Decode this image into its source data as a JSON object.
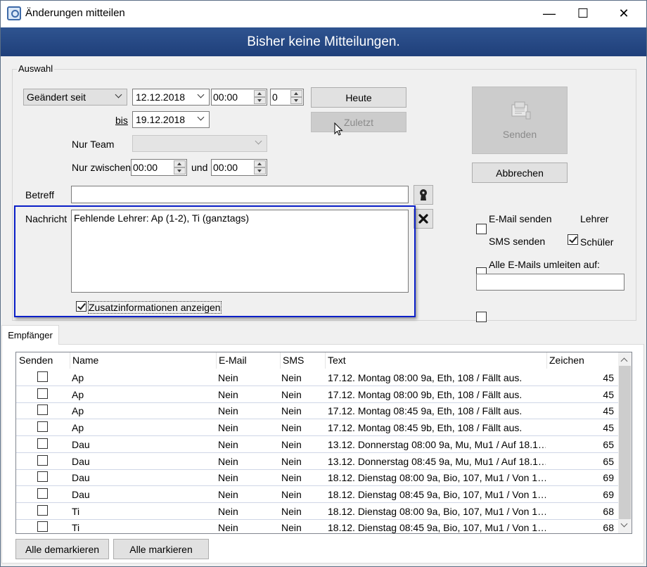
{
  "window": {
    "title": "Änderungen mitteilen",
    "min_glyph": "—",
    "max_glyph": "☐",
    "close_glyph": "✕"
  },
  "banner": {
    "text": "Bisher keine Mitteilungen."
  },
  "auswahl": {
    "legend": "Auswahl",
    "mode_select": "Geändert seit",
    "date_from": "12.12.2018",
    "time_from": "00:00",
    "offset": "0",
    "bis_label": "bis",
    "date_to": "19.12.2018",
    "heute_button": "Heute",
    "zuletzt_button": "Zuletzt",
    "nur_team_label": "Nur Team",
    "nur_team_value": "",
    "nur_zwischen_label": "Nur zwischen",
    "zwischen_from": "00:00",
    "und_label": "und",
    "zwischen_to": "00:00",
    "senden_button": "Senden",
    "abbrechen_button": "Abbrechen",
    "betreff_label": "Betreff",
    "betreff_value": "",
    "nachricht_label": "Nachricht",
    "nachricht_value": "Fehlende Lehrer: Ap (1-2), Ti (ganztags)",
    "zusatz_label": "Zusatzinformationen anzeigen",
    "zusatz_checked": true,
    "email_senden_label": "E-Mail senden",
    "email_senden_checked": false,
    "lehrer_label": "Lehrer",
    "lehrer_checked": true,
    "sms_senden_label": "SMS senden",
    "sms_senden_checked": false,
    "schueler_label": "Schüler",
    "schueler_checked": false,
    "umleiten_label": "Alle E-Mails umleiten auf:",
    "umleiten_checked": false,
    "umleiten_value": ""
  },
  "tabs": {
    "empfaenger": "Empfänger"
  },
  "table": {
    "headers": {
      "senden": "Senden",
      "name": "Name",
      "email": "E-Mail",
      "sms": "SMS",
      "text": "Text",
      "zeichen": "Zeichen"
    },
    "rows": [
      {
        "senden": false,
        "name": "Ap",
        "email": "Nein",
        "sms": "Nein",
        "text": "17.12. Montag 08:00 9a, Eth, 108 / Fällt aus.",
        "zeichen": "45"
      },
      {
        "senden": false,
        "name": "Ap",
        "email": "Nein",
        "sms": "Nein",
        "text": "17.12. Montag 08:00 9b, Eth, 108 / Fällt aus.",
        "zeichen": "45"
      },
      {
        "senden": false,
        "name": "Ap",
        "email": "Nein",
        "sms": "Nein",
        "text": "17.12. Montag 08:45 9a, Eth, 108 / Fällt aus.",
        "zeichen": "45"
      },
      {
        "senden": false,
        "name": "Ap",
        "email": "Nein",
        "sms": "Nein",
        "text": "17.12. Montag 08:45 9b, Eth, 108 / Fällt aus.",
        "zeichen": "45"
      },
      {
        "senden": false,
        "name": "Dau",
        "email": "Nein",
        "sms": "Nein",
        "text": "13.12. Donnerstag 08:00 9a, Mu, Mu1 / Auf 18.1…",
        "zeichen": "65"
      },
      {
        "senden": false,
        "name": "Dau",
        "email": "Nein",
        "sms": "Nein",
        "text": "13.12. Donnerstag 08:45 9a, Mu, Mu1 / Auf 18.1…",
        "zeichen": "65"
      },
      {
        "senden": false,
        "name": "Dau",
        "email": "Nein",
        "sms": "Nein",
        "text": "18.12. Dienstag 08:00 9a, Bio, 107, Mu1 / Von 1…",
        "zeichen": "69"
      },
      {
        "senden": false,
        "name": "Dau",
        "email": "Nein",
        "sms": "Nein",
        "text": "18.12. Dienstag 08:45 9a, Bio, 107, Mu1 / Von 1…",
        "zeichen": "69"
      },
      {
        "senden": false,
        "name": "Ti",
        "email": "Nein",
        "sms": "Nein",
        "text": "18.12. Dienstag 08:00 9a, Bio, 107, Mu1 / Von 1…",
        "zeichen": "68"
      },
      {
        "senden": false,
        "name": "Ti",
        "email": "Nein",
        "sms": "Nein",
        "text": "18.12. Dienstag 08:45 9a, Bio, 107, Mu1 / Von 1…",
        "zeichen": "68"
      }
    ]
  },
  "footer": {
    "alle_demarkieren": "Alle demarkieren",
    "alle_markieren": "Alle markieren"
  }
}
